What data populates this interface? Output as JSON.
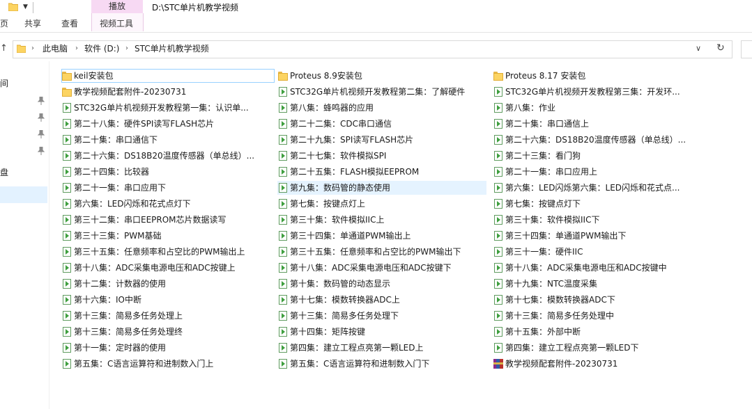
{
  "window": {
    "title": "D:\\STC单片机教学视频",
    "contextual_group": "播放"
  },
  "ribbon": {
    "tabs": [
      "页",
      "共享",
      "查看",
      "视频工具"
    ]
  },
  "address": {
    "crumbs": [
      "此电脑",
      "软件 (D:)",
      "STC单片机教学视频"
    ]
  },
  "nav": {
    "fragments": [
      "间",
      "盘"
    ]
  },
  "colors": {
    "accent_selected": "#cce8ff",
    "contextual_tab": "#f7d9f3",
    "folder": "#fcd462",
    "video_icon": "#3f9f3f"
  },
  "files": [
    [
      {
        "name": "keil安装包",
        "type": "folder"
      },
      {
        "name": "教学视频配套附件-20230731",
        "type": "folder"
      },
      {
        "name": "STC32G单片机视频开发教程第一集：认识单...",
        "type": "video"
      },
      {
        "name": "第二十八集：硬件SPI读写FLASH芯片",
        "type": "video"
      },
      {
        "name": "第二十集：串口通信下",
        "type": "video"
      },
      {
        "name": "第二十六集：DS18B20温度传感器（单总线）...",
        "type": "video"
      },
      {
        "name": "第二十四集：比较器",
        "type": "video"
      },
      {
        "name": "第二十一集：串口应用下",
        "type": "video"
      },
      {
        "name": "第六集：LED闪烁和花式点灯下",
        "type": "video"
      },
      {
        "name": "第三十二集：串口EEPROM芯片数据读写",
        "type": "video"
      },
      {
        "name": "第三十三集：PWM基础",
        "type": "video"
      },
      {
        "name": "第三十五集：任意频率和占空比的PWM输出上",
        "type": "video"
      },
      {
        "name": "第十八集：ADC采集电源电压和ADC按键上",
        "type": "video"
      },
      {
        "name": "第十二集：计数器的使用",
        "type": "video"
      },
      {
        "name": "第十六集：IO中断",
        "type": "video"
      },
      {
        "name": "第十三集：简易多任务处理上",
        "type": "video"
      },
      {
        "name": "第十三集：简易多任务处理终",
        "type": "video"
      },
      {
        "name": "第十一集：定时器的使用",
        "type": "video"
      },
      {
        "name": "第五集：C语言运算符和进制数入门上",
        "type": "video"
      }
    ],
    [
      {
        "name": "Proteus 8.9安装包",
        "type": "folder"
      },
      {
        "name": "STC32G单片机视频开发教程第二集：了解硬件",
        "type": "video"
      },
      {
        "name": "第八集：蜂鸣器的应用",
        "type": "video"
      },
      {
        "name": "第二十二集：CDC串口通信",
        "type": "video"
      },
      {
        "name": "第二十九集：SPI读写FLASH芯片",
        "type": "video"
      },
      {
        "name": "第二十七集：软件模拟SPI",
        "type": "video"
      },
      {
        "name": "第二十五集：FLASH模拟EEPROM",
        "type": "video"
      },
      {
        "name": "第九集：数码管的静态使用",
        "type": "video"
      },
      {
        "name": "第七集：按键点灯上",
        "type": "video"
      },
      {
        "name": "第三十集：软件模拟IIC上",
        "type": "video"
      },
      {
        "name": "第三十四集：单通道PWM输出上",
        "type": "video"
      },
      {
        "name": "第三十五集：任意频率和占空比的PWM输出下",
        "type": "video"
      },
      {
        "name": "第十八集：ADC采集电源电压和ADC按键下",
        "type": "video"
      },
      {
        "name": "第十集：数码管的动态显示",
        "type": "video"
      },
      {
        "name": "第十七集：模数转换器ADC上",
        "type": "video"
      },
      {
        "name": "第十三集：简易多任务处理下",
        "type": "video"
      },
      {
        "name": "第十四集：矩阵按键",
        "type": "video"
      },
      {
        "name": "第四集：建立工程点亮第一颗LED上",
        "type": "video"
      },
      {
        "name": "第五集：C语言运算符和进制数入门下",
        "type": "video"
      }
    ],
    [
      {
        "name": "Proteus 8.17 安装包",
        "type": "folder"
      },
      {
        "name": "STC32G单片机视频开发教程第三集：开发环...",
        "type": "video"
      },
      {
        "name": "第八集：作业",
        "type": "video"
      },
      {
        "name": "第二十集：串口通信上",
        "type": "video"
      },
      {
        "name": "第二十六集：DS18B20温度传感器（单总线）...",
        "type": "video"
      },
      {
        "name": "第二十三集：看门狗",
        "type": "video"
      },
      {
        "name": "第二十一集：串口应用上",
        "type": "video"
      },
      {
        "name": "第六集：LED闪烁第六集：LED闪烁和花式点...",
        "type": "video"
      },
      {
        "name": "第七集：按键点灯下",
        "type": "video"
      },
      {
        "name": "第三十集：软件模拟IIC下",
        "type": "video"
      },
      {
        "name": "第三十四集：单通道PWM输出下",
        "type": "video"
      },
      {
        "name": "第三十一集：硬件IIC",
        "type": "video"
      },
      {
        "name": "第十八集：ADC采集电源电压和ADC按键中",
        "type": "video"
      },
      {
        "name": "第十九集：NTC温度采集",
        "type": "video"
      },
      {
        "name": "第十七集：模数转换器ADC下",
        "type": "video"
      },
      {
        "name": "第十三集：简易多任务处理中",
        "type": "video"
      },
      {
        "name": "第十五集：外部中断",
        "type": "video"
      },
      {
        "name": "第四集：建立工程点亮第一颗LED下",
        "type": "video"
      },
      {
        "name": "教学视频配套附件-20230731",
        "type": "archive"
      }
    ]
  ]
}
